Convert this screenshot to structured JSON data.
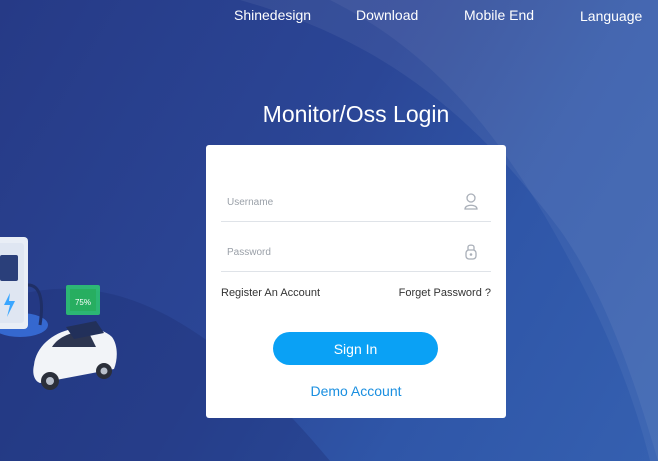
{
  "nav": {
    "items": [
      "Shinedesign",
      "Download",
      "Mobile End",
      "Language"
    ]
  },
  "login": {
    "title": "Monitor/Oss Login",
    "username_placeholder": "Username",
    "password_placeholder": "Password",
    "register_label": "Register An Account",
    "forget_label": "Forget Password ?",
    "signin_label": "Sign In",
    "demo_label": "Demo Account"
  },
  "illustration": {
    "battery_label": "75%"
  },
  "icons": {
    "username": "user-icon",
    "password": "lock-icon"
  },
  "colors": {
    "background": "#2b4696",
    "accent": "#0aa1f5",
    "link": "#1a8fe0"
  }
}
